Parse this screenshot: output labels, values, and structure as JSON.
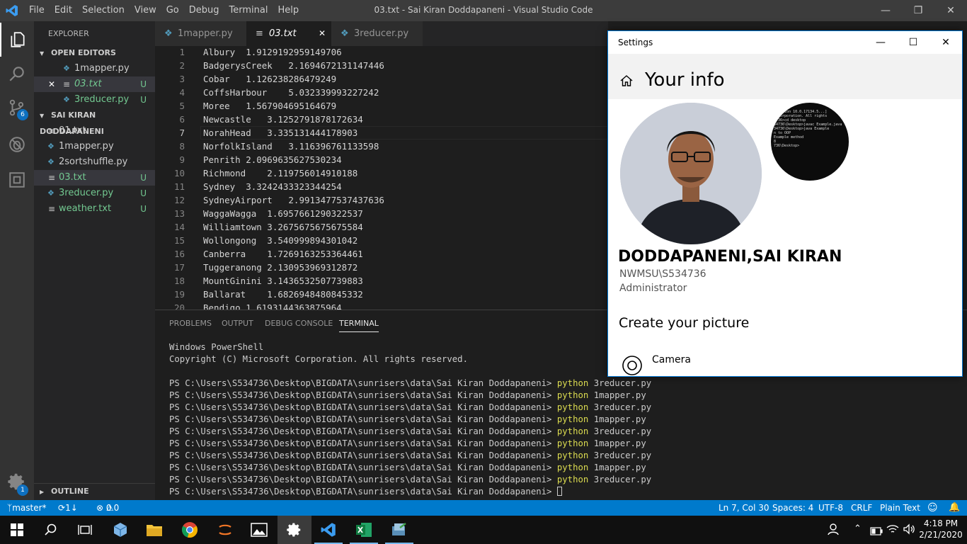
{
  "window": {
    "title": "03.txt - Sai Kiran Doddapaneni - Visual Studio Code",
    "menu": [
      "File",
      "Edit",
      "Selection",
      "View",
      "Go",
      "Debug",
      "Terminal",
      "Help"
    ]
  },
  "activity": {
    "scm_badge": "6",
    "settings_badge": "1"
  },
  "sidebar": {
    "header": "EXPLORER",
    "open_editors_title": "OPEN EDITORS",
    "open_editors": [
      {
        "name": "1mapper.py",
        "status": ""
      },
      {
        "name": "03.txt",
        "status": "U"
      },
      {
        "name": "3reducer.py",
        "status": "U"
      }
    ],
    "folder_title": "SAI KIRAN DODDAPANENI",
    "files": [
      {
        "name": "01.txt",
        "status": ""
      },
      {
        "name": "1mapper.py",
        "status": ""
      },
      {
        "name": "2sortshuffle.py",
        "status": ""
      },
      {
        "name": "03.txt",
        "status": "U"
      },
      {
        "name": "3reducer.py",
        "status": "U"
      },
      {
        "name": "weather.txt",
        "status": "U"
      }
    ],
    "outline_title": "OUTLINE"
  },
  "tabs": [
    "1mapper.py",
    "03.txt",
    "3reducer.py"
  ],
  "editor": {
    "lines": [
      "Albury  1.9129192959149706",
      "BadgerysCreek   2.1694672131147446",
      "Cobar   1.126238286479249",
      "CoffsHarbour    5.032339993227242",
      "Moree   1.567904695164679",
      "Newcastle   3.1252791878172634",
      "NorahHead   3.335131444178903",
      "NorfolkIsland   3.116396761133598",
      "Penrith 2.0969635627530234",
      "Richmond    2.119756014910188",
      "Sydney  3.3242433323344254",
      "SydneyAirport   2.9913477537437636",
      "WaggaWagga  1.6957661290322537",
      "Williamtown 3.2675675675675584",
      "Wollongong  3.540999894301042",
      "Canberra    1.7269163253364461",
      "Tuggeranong 2.130953969312872",
      "MountGinini 3.1436532507739883",
      "Ballarat    1.6826948480845332",
      "Bendigo 1.6193144363875964"
    ],
    "line_numbers": [
      "1",
      "2",
      "3",
      "4",
      "5",
      "6",
      "7",
      "8",
      "9",
      "10",
      "11",
      "12",
      "13",
      "14",
      "15",
      "16",
      "17",
      "18",
      "19",
      "20"
    ]
  },
  "panel": {
    "tabs": [
      "PROBLEMS",
      "OUTPUT",
      "DEBUG CONSOLE",
      "TERMINAL"
    ],
    "header_lines": [
      "Windows PowerShell",
      "Copyright (C) Microsoft Corporation. All rights reserved."
    ],
    "prompt": "PS C:\\Users\\S534736\\Desktop\\BIGDATA\\sunrisers\\data\\Sai Kiran Doddapaneni>",
    "commands": [
      {
        "cmd": "python",
        "arg": "3reducer.py"
      },
      {
        "cmd": "python",
        "arg": "1mapper.py"
      },
      {
        "cmd": "python",
        "arg": "3reducer.py"
      },
      {
        "cmd": "python",
        "arg": "1mapper.py"
      },
      {
        "cmd": "python",
        "arg": "3reducer.py"
      },
      {
        "cmd": "python",
        "arg": "1mapper.py"
      },
      {
        "cmd": "python",
        "arg": "3reducer.py"
      },
      {
        "cmd": "python",
        "arg": "1mapper.py"
      },
      {
        "cmd": "python",
        "arg": "3reducer.py"
      }
    ]
  },
  "status": {
    "branch": "master*",
    "sync": "1↓ 0↑",
    "errors": "0",
    "warnings": "0",
    "position": "Ln 7, Col 30",
    "spaces": "Spaces: 4",
    "encoding": "UTF-8",
    "eol": "CRLF",
    "language": "Plain Text"
  },
  "settings": {
    "title": "Settings",
    "page_title": "Your info",
    "name": "DODDAPANENI,SAI KIRAN",
    "account": "NWMSU\\S534736",
    "role": "Administrator",
    "create_picture": "Create your picture",
    "camera": "Camera",
    "thumb_lines": [
      "[Version 10.0.17134.5...]",
      "t Corporation. All rights",
      "",
      "4736>cd desktop",
      "",
      "34736\\Desktop>javac Example.java",
      "",
      "34736\\Desktop>java Example",
      "n to OOP",
      "Example method",
      "8",
      "",
      "736\\Desktop>"
    ]
  },
  "taskbar": {
    "time": "4:18 PM",
    "date": "2/21/2020"
  }
}
